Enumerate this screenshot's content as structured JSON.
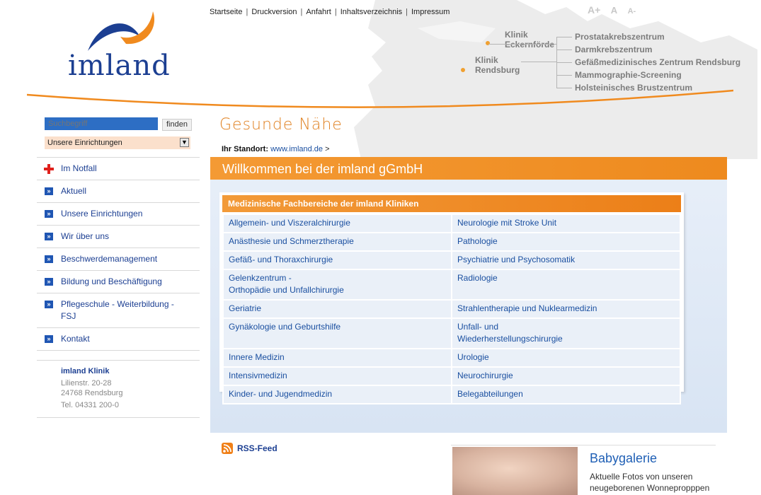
{
  "brand": {
    "logo_text": "imland",
    "accent": "#f08a1e",
    "primary": "#1c3f92"
  },
  "topnav": [
    "Startseite",
    "Druckversion",
    "Anfahrt",
    "Inhaltsverzeichnis",
    "Impressum"
  ],
  "font_size_controls": [
    "A+",
    "A",
    "A-"
  ],
  "map": {
    "clinics": [
      {
        "line1": "Klinik",
        "line2": "Eckernförde"
      },
      {
        "line1": "Klinik",
        "line2": "Rendsburg"
      }
    ],
    "centers": [
      "Prostatakrebszentrum",
      "Darmkrebszentrum",
      "Gefäßmedizinisches Zentrum Rendsburg",
      "Mammographie-Screening",
      "Holsteinisches Brustzentrum"
    ]
  },
  "search": {
    "placeholder": "Suchbegriff",
    "button": "finden",
    "select_value": "Unsere Einrichtungen"
  },
  "sidebar": {
    "items": [
      {
        "label": "Im Notfall",
        "icon": "red-cross-icon"
      },
      {
        "label": "Aktuell",
        "icon": "double-arrow-icon"
      },
      {
        "label": "Unsere Einrichtungen",
        "icon": "double-arrow-icon"
      },
      {
        "label": "Wir über uns",
        "icon": "double-arrow-icon"
      },
      {
        "label": "Beschwerdemanagement",
        "icon": "double-arrow-icon"
      },
      {
        "label": "Bildung und Beschäftigung",
        "icon": "double-arrow-icon"
      },
      {
        "label": "Pflegeschule - Weiterbildung - FSJ",
        "icon": "double-arrow-icon"
      },
      {
        "label": "Kontakt",
        "icon": "double-arrow-icon"
      }
    ],
    "address": {
      "name": "imland Klinik",
      "street": "Lilienstr. 20-28",
      "city": "24768 Rendsburg",
      "phone": "Tel. 04331 200-0"
    }
  },
  "main": {
    "slogan": "Gesunde Nähe",
    "breadcrumb_label": "Ihr Standort:",
    "breadcrumb_link": "www.imland.de",
    "breadcrumb_sep": ">",
    "title": "Willkommen bei der imland gGmbH",
    "panel_title": "Medizinische Fachbereiche der imland Kliniken",
    "departments": [
      [
        "Allgemein- und Viszeralchirurgie",
        "Neurologie mit Stroke Unit"
      ],
      [
        "Anästhesie und Schmerztherapie",
        "Pathologie"
      ],
      [
        "Gefäß- und Thoraxchirurgie",
        "Psychiatrie und Psychosomatik"
      ],
      [
        "Gelenkzentrum -\nOrthopädie und Unfallchirurgie",
        "Radiologie"
      ],
      [
        "Geriatrie",
        "Strahlentherapie und Nuklearmedizin"
      ],
      [
        "Gynäkologie und Geburtshilfe",
        "Unfall- und\nWiederherstellungschirurgie"
      ],
      [
        "Innere Medizin",
        "Urologie"
      ],
      [
        "Intensivmedizin",
        "Neurochirurgie"
      ],
      [
        "Kinder- und Jugendmedizin",
        "Belegabteilungen"
      ]
    ],
    "rss": "RSS-Feed",
    "baby": {
      "title": "Babygalerie",
      "text": "Aktuelle Fotos von unseren neugeborenen Wonnepropppen"
    }
  }
}
